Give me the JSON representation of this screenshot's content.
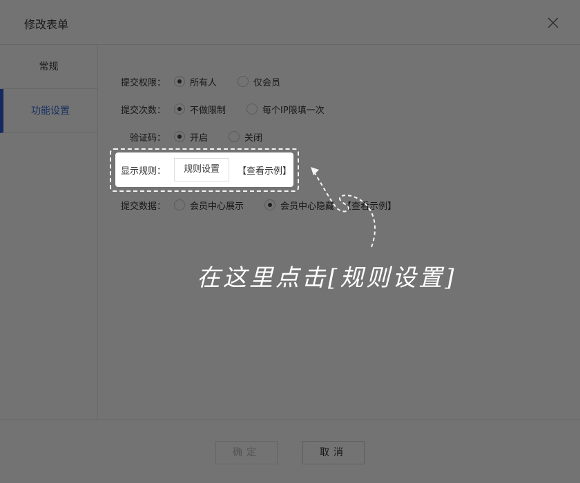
{
  "dialog": {
    "title": "修改表单",
    "close_icon": "close-icon"
  },
  "sidebar": {
    "items": [
      {
        "label": "常规",
        "active": false
      },
      {
        "label": "功能设置",
        "active": true
      }
    ]
  },
  "form": {
    "submit_permission": {
      "label": "提交权限：",
      "options": [
        "所有人",
        "仅会员"
      ],
      "selected": "所有人"
    },
    "submit_times": {
      "label": "提交次数：",
      "options": [
        "不做限制",
        "每个IP限填一次"
      ],
      "selected": "不做限制"
    },
    "captcha": {
      "label": "验证码：",
      "options": [
        "开启",
        "关闭"
      ],
      "selected": "开启"
    },
    "display_rules": {
      "label": "显示规则：",
      "button_label": "规则设置",
      "example_link": "【查看示例】"
    },
    "submit_data": {
      "label": "提交数据：",
      "options": [
        "会员中心展示",
        "会员中心隐藏"
      ],
      "selected": "会员中心隐藏",
      "example_link": "【查看示例】"
    }
  },
  "footer": {
    "ok_label": "确定",
    "cancel_label": "取消"
  },
  "annotation": {
    "text": "在这里点击[规则设置]"
  },
  "colors": {
    "accent": "#2e5bd6",
    "overlay": "rgba(0,0,0,0.55)"
  }
}
